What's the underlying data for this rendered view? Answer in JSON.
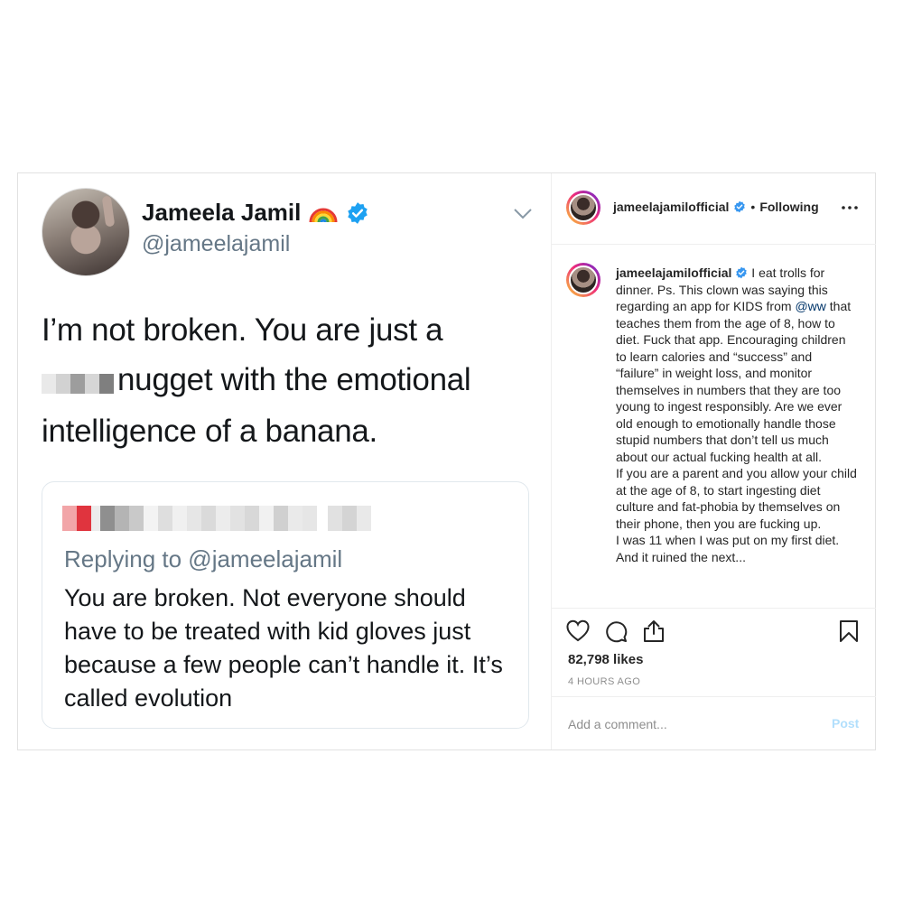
{
  "tweet": {
    "name": "Jameela Jamil",
    "handle": "@jameelajamil",
    "text_line1": "I’m not broken. You are just a",
    "text_line2_after_blur": "nugget with the emotional",
    "text_line3": "intelligence of a banana.",
    "quote": {
      "replying_to": "Replying to @jameelajamil",
      "text": "You are broken. Not everyone should have to be treated with kid gloves just because a few people can’t handle it. It’s called evolution"
    },
    "icons": [
      "rainbow-icon",
      "verified-icon",
      "chevron-down-icon"
    ],
    "colors": {
      "verified": "#1da1f2",
      "secondary_text": "#657786"
    }
  },
  "instagram": {
    "username": "jameelajamilofficial",
    "separator": "•",
    "following": "Following",
    "caption_user": "jameelajamilofficial",
    "caption_part1": " I eat trolls for dinner. Ps. This clown was saying this regarding an app for KIDS from ",
    "caption_mention": "@ww",
    "caption_part2": " that teaches them from the age of 8, how to diet. Fuck that app. Encouraging children to learn calories and “success” and “failure” in weight loss, and monitor themselves in numbers that they are too young to ingest responsibly. Are we ever old enough to emotionally handle those stupid numbers that don’t tell us much about our actual fucking health at all.\nIf you are a parent and you allow your child at the age of 8, to start ingesting diet culture and fat-phobia by themselves on their phone, then you are fucking up.\nI was 11 when I was put on my first diet. And it ruined the next...",
    "likes": "82,798 likes",
    "time": "4 HOURS AGO",
    "comment_placeholder": "Add a comment...",
    "post_label": "Post",
    "icons": [
      "heart-icon",
      "comment-icon",
      "share-icon",
      "bookmark-icon",
      "more-icon",
      "verified-icon"
    ],
    "colors": {
      "post_disabled": "#b2dffc",
      "mention": "#003569",
      "meta": "#8e8e8e"
    }
  }
}
